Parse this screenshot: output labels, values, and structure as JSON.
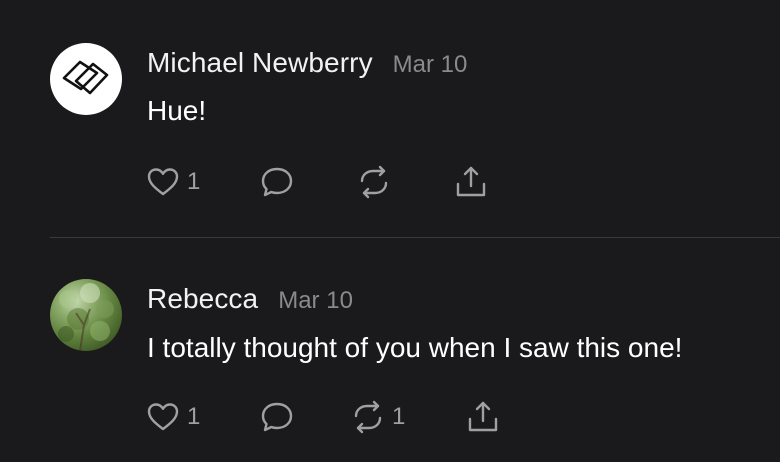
{
  "comments": [
    {
      "author": "Michael Newberry",
      "date": "Mar 10",
      "text": "Hue!",
      "avatar": "logo-avatar",
      "likes": "1",
      "restacks": ""
    },
    {
      "author": "Rebecca",
      "date": "Mar 10",
      "text": "I totally thought of you when I saw this one!",
      "avatar": "photo-avatar",
      "likes": "1",
      "restacks": "1"
    }
  ],
  "colors": {
    "background": "#1a1a1c",
    "text": "#ffffff",
    "muted": "#8a8a8d",
    "divider": "#3a3a3c"
  },
  "icons": [
    "heart-icon",
    "comment-icon",
    "restack-icon",
    "share-icon"
  ]
}
